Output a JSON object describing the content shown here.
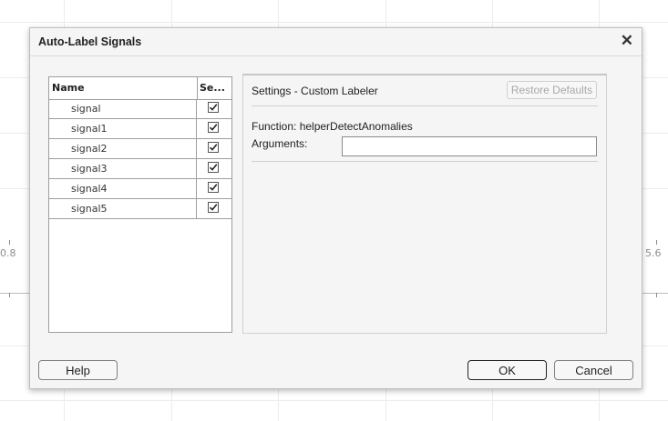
{
  "background": {
    "axis_tick_left": "0.8",
    "axis_tick_right": "5.6"
  },
  "dialog": {
    "title": "Auto-Label Signals",
    "close_icon": "close-icon"
  },
  "table": {
    "columns": [
      "Name",
      "Se..."
    ],
    "rows": [
      {
        "name": "signal",
        "selected": true
      },
      {
        "name": "signal1",
        "selected": true
      },
      {
        "name": "signal2",
        "selected": true
      },
      {
        "name": "signal3",
        "selected": true
      },
      {
        "name": "signal4",
        "selected": true
      },
      {
        "name": "signal5",
        "selected": true
      }
    ]
  },
  "settings": {
    "title": "Settings - Custom Labeler",
    "restore_label": "Restore Defaults",
    "function_label": "Function: helperDetectAnomalies",
    "arguments_label": "Arguments:",
    "arguments_value": ""
  },
  "footer": {
    "help_label": "Help",
    "ok_label": "OK",
    "cancel_label": "Cancel"
  },
  "colors": {
    "dialog_bg": "#f5f5f5",
    "border": "#9e9e9e",
    "disabled_text": "#a8a8a8"
  }
}
